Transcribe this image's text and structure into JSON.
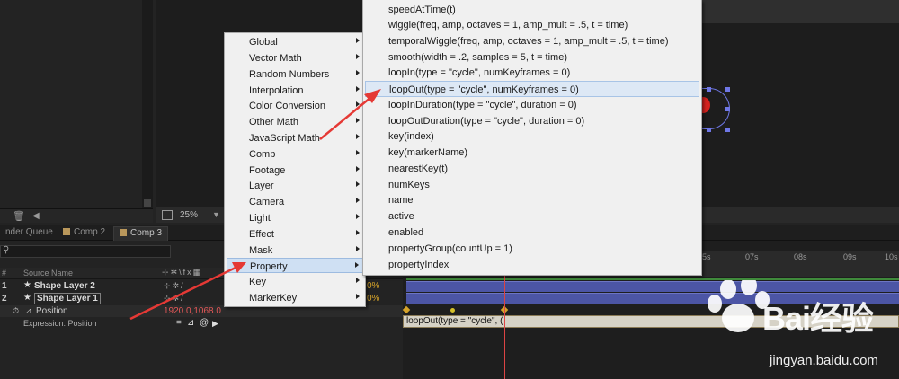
{
  "viewer": {
    "zoom": "25%"
  },
  "tabs": [
    {
      "label": "nder Queue"
    },
    {
      "label": "Comp 2"
    },
    {
      "label": "Comp 3"
    }
  ],
  "timeline": {
    "col_hash": "#",
    "col_source": "Source Name",
    "layers": [
      {
        "num": "1",
        "name": "Shape Layer 2",
        "pct": "0%"
      },
      {
        "num": "2",
        "name": "Shape Layer 1",
        "pct": "0%"
      }
    ],
    "property": {
      "name": "Position",
      "value": "1920.0,1068.0"
    },
    "expression_label": "Expression: Position",
    "expression_text": "loopOut(type = \"cycle\", (",
    "ruler": [
      "05s",
      "07s",
      "08s",
      "09s",
      "10s"
    ]
  },
  "menu_categories": [
    "Global",
    "Vector Math",
    "Random Numbers",
    "Interpolation",
    "Color Conversion",
    "Other Math",
    "JavaScript Math",
    "Comp",
    "Footage",
    "Layer",
    "Camera",
    "Light",
    "Effect",
    "Mask",
    "Property",
    "Key",
    "MarkerKey"
  ],
  "menu_property_items": [
    "speedAtTime(t)",
    "wiggle(freq, amp, octaves = 1, amp_mult = .5, t = time)",
    "temporalWiggle(freq, amp, octaves = 1, amp_mult = .5, t = time)",
    "smooth(width = .2, samples = 5, t = time)",
    "loopIn(type = \"cycle\", numKeyframes = 0)",
    "loopOut(type = \"cycle\", numKeyframes = 0)",
    "loopInDuration(type = \"cycle\", duration = 0)",
    "loopOutDuration(type = \"cycle\", duration = 0)",
    "key(index)",
    "key(markerName)",
    "nearestKey(t)",
    "numKeys",
    "name",
    "active",
    "enabled",
    "propertyGroup(countUp = 1)",
    "propertyIndex"
  ],
  "watermark": {
    "text": "Bai经验",
    "url": "jingyan.baidu.com"
  },
  "colors": {
    "menu_bg": "#f0f0f0",
    "highlight": "#cfe0f3",
    "arrow": "#e53935",
    "keyframe": "#d5a32a"
  }
}
